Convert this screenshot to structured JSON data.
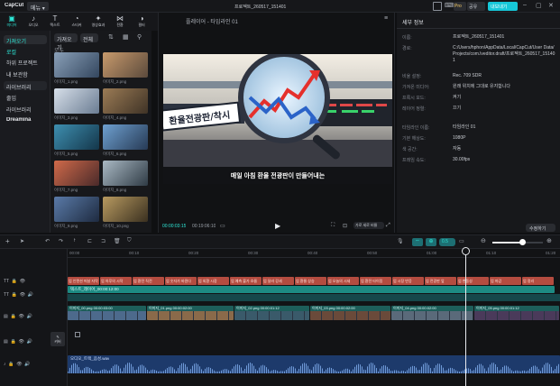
{
  "app": {
    "name": "CapCut",
    "menu_label": "메뉴",
    "project_title": "프로젝트_260517_151401",
    "pro_label": "Pro",
    "share_label": "공유",
    "export_label": "내보내기"
  },
  "colors": {
    "accent": "#2ee6d6",
    "export_bg": "#16c7d8",
    "clip_red": "#b44c40",
    "clip_teal": "#1d8a82",
    "audio": "#27508f"
  },
  "toolbar": {
    "tabs": [
      {
        "icon": "media-icon",
        "label": "미디어"
      },
      {
        "icon": "audio-icon",
        "label": "오디오"
      },
      {
        "icon": "text-icon",
        "label": "텍스트"
      },
      {
        "icon": "sticker-icon",
        "label": "스티커"
      },
      {
        "icon": "effects-icon",
        "label": "영상효과"
      },
      {
        "icon": "transition-icon",
        "label": "전환"
      },
      {
        "icon": "filter-icon",
        "label": "필터"
      }
    ]
  },
  "sidebar": {
    "items": [
      {
        "label": "가져오기"
      },
      {
        "label": "로컬"
      },
      {
        "label": "하위 프로젝트"
      },
      {
        "label": "내 보관함"
      },
      {
        "label": "라이브러리"
      },
      {
        "label": "줄입"
      },
      {
        "label": "라이브러리"
      },
      {
        "label": "Dreamina"
      }
    ]
  },
  "media": {
    "import_label": "가져오기",
    "all_label": "전체",
    "filter_label": "모두",
    "items": [
      {
        "name": "이미지_1.png"
      },
      {
        "name": "이미지_2.png"
      },
      {
        "name": "이미지_3.png"
      },
      {
        "name": "이미지_4.png"
      },
      {
        "name": "이미지_5.png"
      },
      {
        "name": "이미지_6.png"
      },
      {
        "name": "이미지_7.png"
      },
      {
        "name": "이미지_8.png"
      },
      {
        "name": "이미지_9.png"
      },
      {
        "name": "이미지_10.png"
      }
    ]
  },
  "player": {
    "title": "플레이어 - 타임라인 01",
    "sign_text": "환율전광판/착시",
    "subtitle": "매일 아침 환율 전광판이 만들어내는",
    "current_time": "00:00:03:15",
    "total_time": "00:19:06:10",
    "ratio_label": "가로 세로 비율"
  },
  "details": {
    "header": "세부 정보",
    "rows": [
      {
        "label": "이름:",
        "value": "프로젝트_260517_151401"
      },
      {
        "label": "경로:",
        "value": "C:/Users/hphon/AppData/Local/CapCut/User Data/Projects/com.lveditor.draft/프로젝트_260517_151401"
      },
      {
        "label": "비율 설정:",
        "value": "Rec. 709 SDR"
      },
      {
        "label": "가져온 미디어:",
        "value": "원래 위치에 그대로 유지합니다"
      },
      {
        "label": "프록시 모드:",
        "value": "켜기"
      },
      {
        "label": "레이어 정렬:",
        "value": "끄기"
      },
      {
        "label": "타임라인 이름:",
        "value": "타임라인 01"
      },
      {
        "label": "기본 해상도:",
        "value": "1080P"
      },
      {
        "label": "색 공간:",
        "value": "자동"
      },
      {
        "label": "프레임 속도:",
        "value": "30.00fps"
      }
    ],
    "modify_label": "수정하기"
  },
  "timeline": {
    "ticks": [
      "00:00",
      "00:10",
      "00:20",
      "00:30",
      "00:40",
      "00:50",
      "01:00",
      "01:10",
      "01:20"
    ],
    "zoom_value": "0.5",
    "subtitle_clips": [
      "엄 인텐션 떠날 자막",
      "엄 하루의 시작",
      "엄 환전 직전",
      "엄 숫자가 바뀐다",
      "엄 외환 시장",
      "엄 예측 불가 흐름",
      "엄 달러 강세",
      "엄 환율 상승",
      "엄 오늘의 시세",
      "엄 환전 타이밍",
      "엄 시장 반응",
      "엄 전광판 앞",
      "엄 변동성",
      "엄 마감",
      "엄 정리"
    ],
    "text_clip": "텍스트_레이어_00:00:12:00",
    "video_clips": [
      {
        "label": "이미지_00.png  00:00:03:00"
      },
      {
        "label": "이미지_01.png  00:00:02:00"
      },
      {
        "label": "이미지_02.png  00:00:01:12"
      },
      {
        "label": "이미지_03.png  00:00:02:00"
      },
      {
        "label": "이미지_04.png  00:00:02:00"
      },
      {
        "label": "이미지_05.png  00:00:01:12"
      }
    ],
    "cover_label": "커버",
    "audio_label": "오디오_트랙_음성.wav"
  }
}
